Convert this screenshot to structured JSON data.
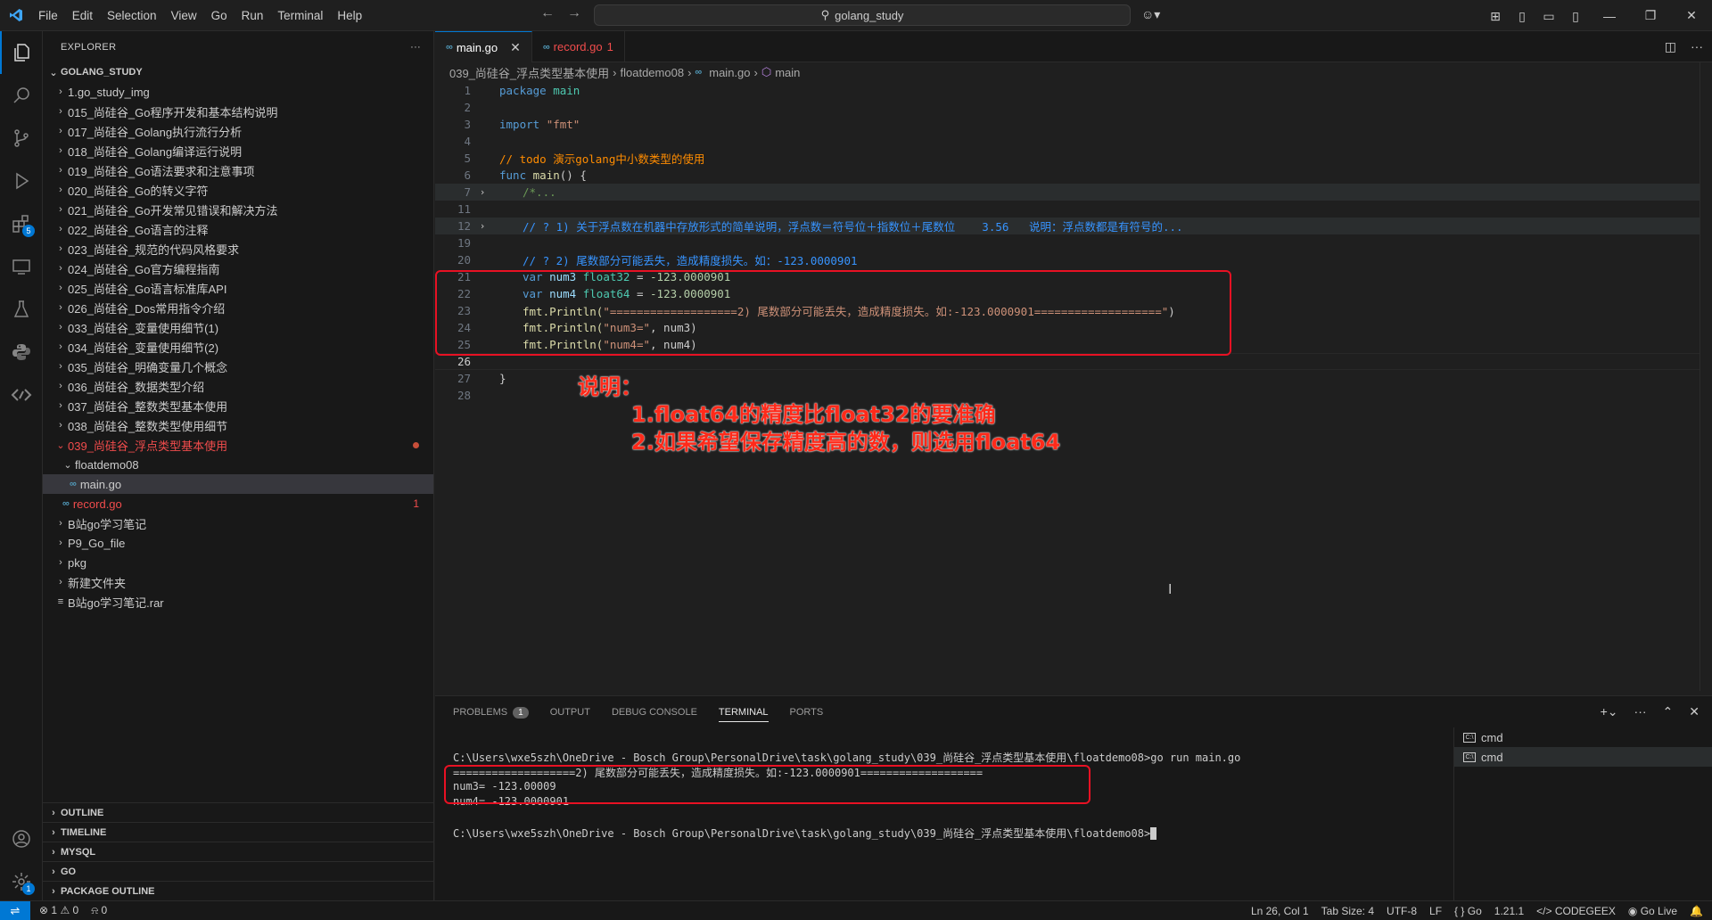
{
  "titlebar": {
    "menu": [
      "File",
      "Edit",
      "Selection",
      "View",
      "Go",
      "Run",
      "Terminal",
      "Help"
    ],
    "search": "golang_study"
  },
  "activity": {
    "extensions_badge": "5",
    "settings_badge": "1"
  },
  "explorer": {
    "title": "EXPLORER",
    "root": "GOLANG_STUDY",
    "items": [
      "1.go_study_img",
      "015_尚硅谷_Go程序开发和基本结构说明",
      "017_尚硅谷_Golang执行流行分析",
      "018_尚硅谷_Golang编译运行说明",
      "019_尚硅谷_Go语法要求和注意事项",
      "020_尚硅谷_Go的转义字符",
      "021_尚硅谷_Go开发常见错误和解决方法",
      "022_尚硅谷_Go语言的注释",
      "023_尚硅谷_规范的代码风格要求",
      "024_尚硅谷_Go官方编程指南",
      "025_尚硅谷_Go语言标准库API",
      "026_尚硅谷_Dos常用指令介绍",
      "033_尚硅谷_变量使用细节(1)",
      "034_尚硅谷_变量使用细节(2)",
      "035_尚硅谷_明确变量几个概念",
      "036_尚硅谷_数据类型介绍",
      "037_尚硅谷_整数类型基本使用",
      "038_尚硅谷_整数类型使用细节"
    ],
    "open_folder": "039_尚硅谷_浮点类型基本使用",
    "subfolder": "floatdemo08",
    "selected_file": "main.go",
    "record_file": "record.go",
    "record_errors": "1",
    "after_items": [
      "B站go学习笔记",
      "P9_Go_file",
      "pkg",
      "新建文件夹"
    ],
    "rar_file": "B站go学习笔记.rar",
    "sections": [
      "OUTLINE",
      "TIMELINE",
      "MYSQL",
      "GO",
      "PACKAGE OUTLINE"
    ]
  },
  "tabs": [
    {
      "label": "main.go"
    },
    {
      "label": "record.go",
      "badge": "1"
    }
  ],
  "breadcrumb": [
    "039_尚硅谷_浮点类型基本使用",
    "floatdemo08",
    "main.go",
    "main"
  ],
  "code_lines": {
    "l1_kw": "package",
    "l1_rest": " main",
    "l3_kw": "import",
    "l3_str": "\"fmt\"",
    "l5": "// todo 演示golang中小数类型的使用",
    "l6_kw": "func",
    "l6_fn": "main",
    "l6_rest": "() {",
    "l7": "/*...",
    "l12": "// ? 1) 关于浮点数在机器中存放形式的简单说明，浮点数＝符号位＋指数位＋尾数位    3.56   说明：浮点数都是有符号的...",
    "l20": "// ? 2) 尾数部分可能丢失，造成精度损失。如：-123.0000901",
    "l21_var": "var",
    "l21_name": "num3",
    "l21_type": "float32",
    "l21_eq": " = ",
    "l21_val": "-123.0000901",
    "l22_var": "var",
    "l22_name": "num4",
    "l22_type": "float64",
    "l22_eq": " = ",
    "l22_val": "-123.0000901",
    "l23_fn": "fmt.Println(",
    "l23_str": "\"===================2) 尾数部分可能丢失，造成精度损失。如:-123.0000901===================\"",
    "l23_end": ")",
    "l24_fn": "fmt.Println(",
    "l24_str": "\"num3=\"",
    "l24_rest": ", num3)",
    "l25_fn": "fmt.Println(",
    "l25_str": "\"num4=\"",
    "l25_rest": ", num4)",
    "l27": "}"
  },
  "annotation": {
    "title": "说明：",
    "line1": "1.float64的精度比float32的要准确",
    "line2": "2.如果希望保存精度高的数，则选用float64"
  },
  "panel": {
    "tabs": [
      "PROBLEMS",
      "OUTPUT",
      "DEBUG CONSOLE",
      "TERMINAL",
      "PORTS"
    ],
    "problems_badge": "1",
    "terminal_lines": [
      "C:\\Users\\wxe5szh\\OneDrive - Bosch Group\\PersonalDrive\\task\\golang_study\\039_尚硅谷_浮点类型基本使用\\floatdemo08>go run main.go",
      "===================2) 尾数部分可能丢失，造成精度损失。如:-123.0000901===================",
      "num3= -123.00009",
      "num4= -123.0000901",
      "",
      "C:\\Users\\wxe5szh\\OneDrive - Bosch Group\\PersonalDrive\\task\\golang_study\\039_尚硅谷_浮点类型基本使用\\floatdemo08>"
    ],
    "terminals": [
      "cmd",
      "cmd"
    ]
  },
  "status": {
    "errors": "1",
    "warnings": "0",
    "ports": "0",
    "position": "Ln 26, Col 1",
    "tab_size": "Tab Size: 4",
    "encoding": "UTF-8",
    "eol": "LF",
    "language": "Go",
    "go_version": "1.21.1",
    "codegeex": "CODEGEEX",
    "golive": "Go Live"
  },
  "colors": {
    "accent": "#0078d4",
    "annotation_red": "#ff2a1a"
  }
}
